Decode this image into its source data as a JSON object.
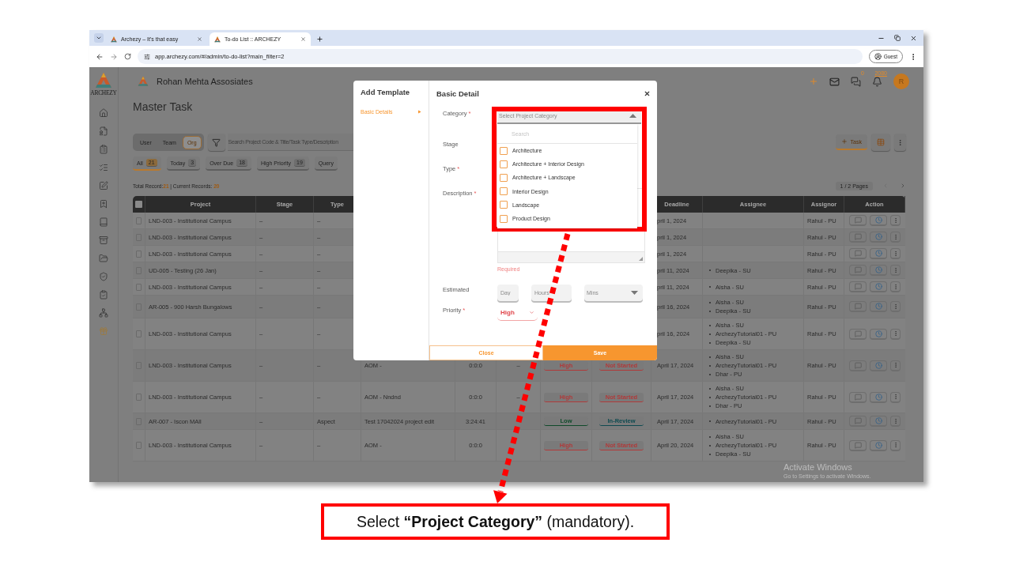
{
  "browser": {
    "tabs": [
      {
        "title": "Archezy – It's that easy",
        "selected": false
      },
      {
        "title": "To-do List :: ARCHEZY",
        "selected": true
      }
    ],
    "url": "app.archezy.com/#/admin/to-do-list?main_filter=2",
    "profile": "Guest"
  },
  "sidebar": {
    "logo_text": "ARCHEZY"
  },
  "header": {
    "company": "Rohan Mehta Assosiates",
    "chat_count": "0",
    "notification_count": "2080",
    "avatar": "R"
  },
  "page_title": "Master Task",
  "scope_toggle": [
    {
      "label": "User",
      "selected": false
    },
    {
      "label": "Team",
      "selected": false
    },
    {
      "label": "Org",
      "selected": true
    }
  ],
  "search": {
    "placeholder": "Search Project Code & Title/Task Type/Description"
  },
  "add_button": "Task",
  "filters": [
    {
      "label": "All",
      "count": "21",
      "selected": true
    },
    {
      "label": "Today",
      "count": "3",
      "selected": false
    },
    {
      "label": "Over Due",
      "count": "18",
      "selected": false
    },
    {
      "label": "High Priority",
      "count": "19",
      "selected": false
    },
    {
      "label": "Query",
      "selected": false
    }
  ],
  "summary": "Total Record:**21** | Current Records: **20**",
  "pagination": "1 / 2 Pages",
  "table": {
    "header_checked": false,
    "columns": [
      "Project",
      "Stage",
      "Type",
      "Deadline",
      "Assignee",
      "Assignor",
      "Action"
    ],
    "rows": [
      {
        "checked": false,
        "project": "LND-003 - Institutional Campus",
        "stage": "–",
        "type": "–",
        "deadline": "pril 1, 2024",
        "assignees": [],
        "assignor": "Rahul - PU"
      },
      {
        "checked": false,
        "project": "LND-003 - Institutional Campus",
        "stage": "–",
        "type": "–",
        "deadline": "pril 1, 2024",
        "assignees": [],
        "assignor": "Rahul - PU"
      },
      {
        "checked": false,
        "project": "LND-003 - Institutional Campus",
        "stage": "–",
        "type": "–",
        "deadline": "pril 1, 2024",
        "assignees": [],
        "assignor": "Rahul - PU"
      },
      {
        "checked": false,
        "project": "UD-005 - Testing (26 Jan)",
        "stage": "–",
        "type": "–",
        "deadline": "pril 11, 2024",
        "assignees": [
          "Deepika - SU"
        ],
        "assignor": "Rahul - PU"
      },
      {
        "checked": false,
        "project": "LND-003 - Institutional Campus",
        "stage": "–",
        "type": "–",
        "deadline": "pril 11, 2024",
        "assignees": [
          "Aisha - SU"
        ],
        "assignor": "Rahul - PU"
      },
      {
        "checked": false,
        "project": "AR-005 - 900 Harsh Bungalows",
        "stage": "–",
        "type": "–",
        "deadline": "pril 16, 2024",
        "assignees": [
          "Aisha - SU",
          "Deepika - SU"
        ],
        "assignor": "Rahul - PU"
      },
      {
        "checked": false,
        "project": "LND-003 - Institutional Campus",
        "stage": "–",
        "type": "–",
        "deadline": "pril 16, 2024",
        "assignees": [
          "Aisha - SU",
          "ArchezyTutorial01 - PU",
          "Deepika - SU"
        ],
        "assignor": "Rahul - PU"
      },
      {
        "checked": false,
        "project": "LND-003 - Institutional Campus",
        "stage": "–",
        "type": "–",
        "title": "AOM -",
        "time": "0:0:0",
        "column_7": "–",
        "priority": {
          "text": "High",
          "color": "#b03a3a"
        },
        "status": {
          "text": "Not Started",
          "color": "#b03a3a"
        },
        "deadline": "April 17, 2024",
        "assignees": [
          "Aisha - SU",
          "ArchezyTutorial01 - PU",
          "Dhar - PU"
        ],
        "assignor": "Rahul - PU"
      },
      {
        "checked": false,
        "project": "LND-003 - Institutional Campus",
        "stage": "–",
        "type": "–",
        "title": "AOM - Nndnd",
        "time": "0:0:0",
        "column_7": "–",
        "priority": {
          "text": "High",
          "color": "#b03a3a"
        },
        "status": {
          "text": "Not Started",
          "color": "#b03a3a"
        },
        "deadline": "April 17, 2024",
        "assignees": [
          "Aisha - SU",
          "ArchezyTutorial01 - PU",
          "Dhar - PU"
        ],
        "assignor": "Rahul - PU"
      },
      {
        "checked": false,
        "project": "AR-007 - Iscon MAll",
        "stage": "–",
        "type": "Aspect",
        "title": "Test 17042024 project edit",
        "time": "3:24:41",
        "priority": {
          "text": "Low",
          "color": "#0f4a2a"
        },
        "status": {
          "text": "In-Review",
          "color": "#0e4a50"
        },
        "deadline": "April 17, 2024",
        "assignees": [
          "ArchezyTutorial01 - PU"
        ],
        "assignor": "Rahul - PU"
      },
      {
        "checked": false,
        "project": "LND-003 - Institutional Campus",
        "stage": "–",
        "type": "–",
        "title": "AOM -",
        "time": "0:0:0",
        "priority": {
          "text": "High",
          "color": "#b03a3a"
        },
        "status": {
          "text": "Not Started",
          "color": "#b03a3a"
        },
        "deadline": "April 20, 2024",
        "assignees": [
          "Aisha - SU",
          "ArchezyTutorial01 - PU",
          "Deepika - SU"
        ],
        "assignor": "Rahul - PU"
      }
    ]
  },
  "modal": {
    "title": "Add Template",
    "steps": [
      {
        "label": "Basic Details",
        "selected": true
      }
    ],
    "section_title": "Basic Detail",
    "fields": [
      {
        "kind": "category",
        "label": "Category",
        "required_mark": "*",
        "placeholder": "Select Project Category",
        "expanded": true,
        "search_placeholder": "Search",
        "options": [
          {
            "label": "Architecture",
            "checked": false
          },
          {
            "label": "Architecture + Interior Design",
            "checked": false
          },
          {
            "label": "Architecture + Landscape",
            "checked": false
          },
          {
            "label": "Interior Design",
            "checked": false
          },
          {
            "label": "Landscape",
            "checked": false
          },
          {
            "label": "Product Design",
            "checked": false
          }
        ]
      },
      {
        "kind": "covered",
        "label": "Stage"
      },
      {
        "kind": "covered",
        "label": "Type",
        "required_mark": "*"
      },
      {
        "kind": "textarea",
        "label": "Description",
        "required_mark": "*",
        "error": "Required"
      },
      {
        "kind": "duration",
        "label": "Estimated",
        "parts": [
          {
            "kind": "input",
            "placeholder": "Day"
          },
          {
            "kind": "input",
            "placeholder": "Hours"
          },
          {
            "kind": "select",
            "placeholder": "Mins"
          }
        ]
      },
      {
        "kind": "select",
        "label": "Priority",
        "required_mark": "*",
        "value": "High"
      }
    ],
    "buttons": {
      "cancel": "Close",
      "confirm": "Save"
    }
  },
  "os_notice": {
    "title": "Activate Windows",
    "subtitle": "Go to Settings to activate Windows."
  },
  "callout": "Select **“Project Category”** (mandatory)."
}
